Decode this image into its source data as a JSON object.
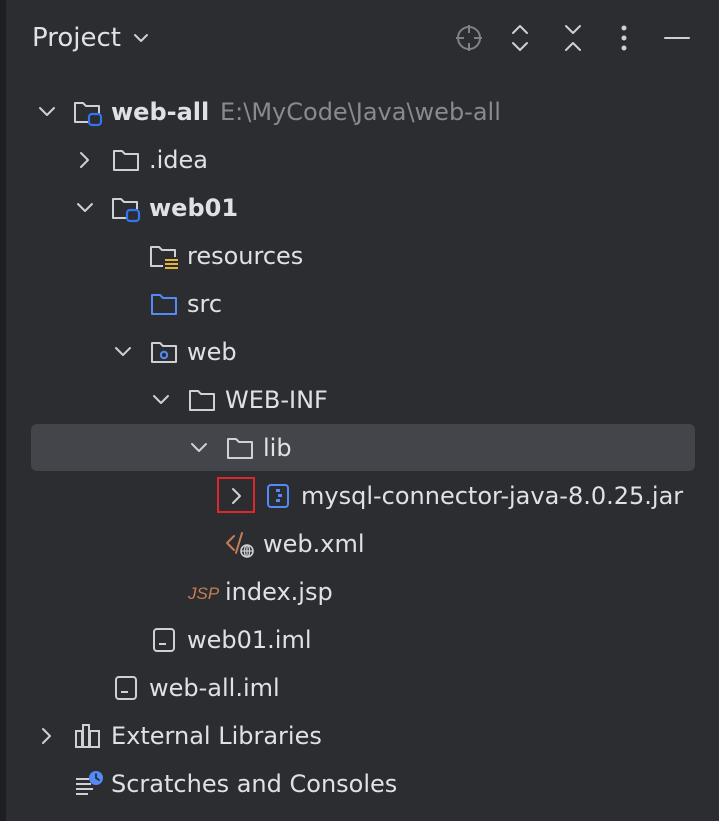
{
  "header": {
    "title": "Project",
    "icons": [
      "locate-icon",
      "expand-all-icon",
      "collapse-all-icon",
      "more-options-icon",
      "hide-icon"
    ]
  },
  "tree": {
    "root": {
      "label": "web-all",
      "path_hint": "E:\\MyCode\\Java\\web-all"
    },
    "idea": "idea",
    "web01": "web01",
    "resources": "resources",
    "src": "src",
    "web": "web",
    "web_inf": "WEB-INF",
    "lib": "lib",
    "jar": "mysql-connector-java-8.0.25.jar",
    "web_xml": "web.xml",
    "index_jsp": "index.jsp",
    "web01_iml": "web01.iml",
    "web_all_iml": "web-all.iml",
    "external_libraries": "External Libraries",
    "scratches": "Scratches and Consoles"
  },
  "colors": {
    "background": "#2b2d30",
    "selection": "#43454a",
    "text": "#dfe1e5",
    "hint_text": "#868a91",
    "module_blue": "#3574f0",
    "highlight_box": "#e0272d",
    "jsp_orange": "#c77d55"
  }
}
